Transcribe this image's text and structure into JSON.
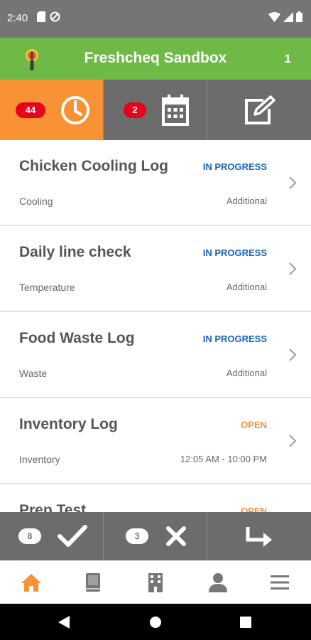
{
  "status_bar": {
    "time": "2:40"
  },
  "app_bar": {
    "title": "Freshcheq Sandbox",
    "count": "1"
  },
  "tabs": [
    {
      "name": "recent",
      "badge": "44",
      "icon": "clock-icon",
      "active": true
    },
    {
      "name": "scheduled",
      "badge": "2",
      "icon": "calendar-icon",
      "active": false
    },
    {
      "name": "compose",
      "icon": "edit-icon",
      "active": false
    }
  ],
  "list": {
    "items": [
      {
        "title": "Chicken Cooling Log",
        "status": "IN PROGRESS",
        "category": "Cooling",
        "meta": "Additional"
      },
      {
        "title": "Daily line check",
        "status": "IN PROGRESS",
        "category": "Temperature",
        "meta": "Additional"
      },
      {
        "title": "Food Waste Log",
        "status": "IN PROGRESS",
        "category": "Waste",
        "meta": "Additional"
      },
      {
        "title": "Inventory Log",
        "status": "OPEN",
        "category": "Inventory",
        "meta": "12:05 AM - 10:00 PM"
      },
      {
        "title": "Prep Test",
        "status": "OPEN",
        "category": "",
        "meta": ""
      }
    ]
  },
  "action_bar": {
    "completed_count": "8",
    "failed_count": "3"
  },
  "colors": {
    "status_in_progress": "#1565c0",
    "status_open": "#f79334",
    "brand_green": "#6fba46",
    "active_orange": "#f79334"
  },
  "bottom_nav": [
    "home-icon",
    "book-icon",
    "building-icon",
    "person-icon",
    "menu-icon"
  ]
}
